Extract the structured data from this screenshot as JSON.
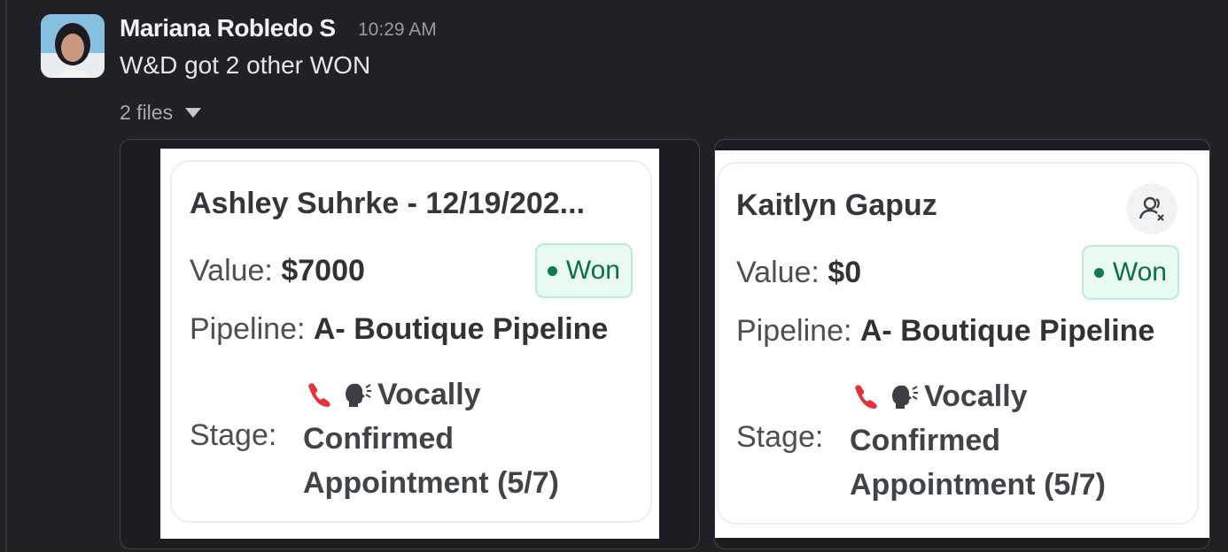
{
  "message": {
    "sender": "Mariana Robledo S",
    "time": "10:29 AM",
    "text": "W&D got 2 other WON",
    "files_label": "2 files"
  },
  "attachments": [
    {
      "deal_name": "Ashley Suhrke - 12/19/202...",
      "value_label": "Value:",
      "value": "$7000",
      "status": "Won",
      "pipeline_label": "Pipeline:",
      "pipeline": "A- Boutique Pipeline",
      "stage_label": "Stage:",
      "stage_line1": "Vocally",
      "stage_line2": "Confirmed",
      "stage_line3": "Appointment (5/7)"
    },
    {
      "deal_name": "Kaitlyn Gapuz",
      "value_label": "Value:",
      "value": "$0",
      "status": "Won",
      "pipeline_label": "Pipeline:",
      "pipeline": "A- Boutique Pipeline",
      "stage_label": "Stage:",
      "stage_line1": "Vocally",
      "stage_line2": "Confirmed",
      "stage_line3": "Appointment (5/7)",
      "icon": "contact-remove-icon"
    }
  ],
  "colors": {
    "background": "#1f2127",
    "won_text": "#0d6e45",
    "won_bg": "#e9faf1"
  }
}
